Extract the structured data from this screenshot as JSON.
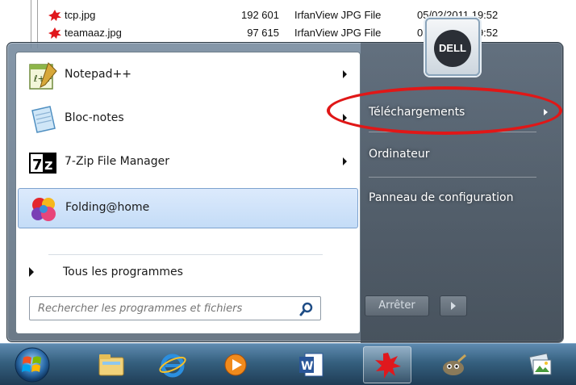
{
  "explorer": {
    "files": [
      {
        "name": "tcp.jpg",
        "size": "192 601",
        "type": "IrfanView JPG File",
        "date": "05/02/2011 19:52"
      },
      {
        "name": "teamaaz.jpg",
        "size": "97 615",
        "type": "IrfanView JPG File",
        "date": "05/02/2011 19:52"
      }
    ]
  },
  "start_menu": {
    "programs": [
      {
        "label": "Notepad++",
        "icon": "notepadpp-icon",
        "has_submenu": true
      },
      {
        "label": "Bloc-notes",
        "icon": "notepad-icon",
        "has_submenu": true
      },
      {
        "label": "7-Zip File Manager",
        "icon": "7zip-icon",
        "has_submenu": true
      },
      {
        "label": "Folding@home",
        "icon": "folding-home-icon",
        "has_submenu": false,
        "selected": true
      }
    ],
    "all_programs_label": "Tous les programmes",
    "search_placeholder": "Rechercher les programmes et fichiers",
    "right_links": [
      {
        "label": "Téléchargements",
        "has_submenu": true
      },
      {
        "label": "Ordinateur",
        "has_submenu": false
      },
      {
        "label": "Panneau de configuration",
        "has_submenu": false
      }
    ],
    "user_picture": "DELL",
    "shutdown_label": "Arrêter"
  },
  "taskbar": {
    "buttons": [
      {
        "name": "explorer-icon"
      },
      {
        "name": "internet-explorer-icon"
      },
      {
        "name": "media-player-icon"
      },
      {
        "name": "word-icon"
      },
      {
        "name": "red-splat-icon",
        "active": true
      },
      {
        "name": "gimp-icon"
      },
      {
        "name": "photo-viewer-icon"
      }
    ]
  },
  "colors": {
    "highlight_ring": "#e01717",
    "selection": "#c4dcf7",
    "taskbar": "#35607f"
  }
}
